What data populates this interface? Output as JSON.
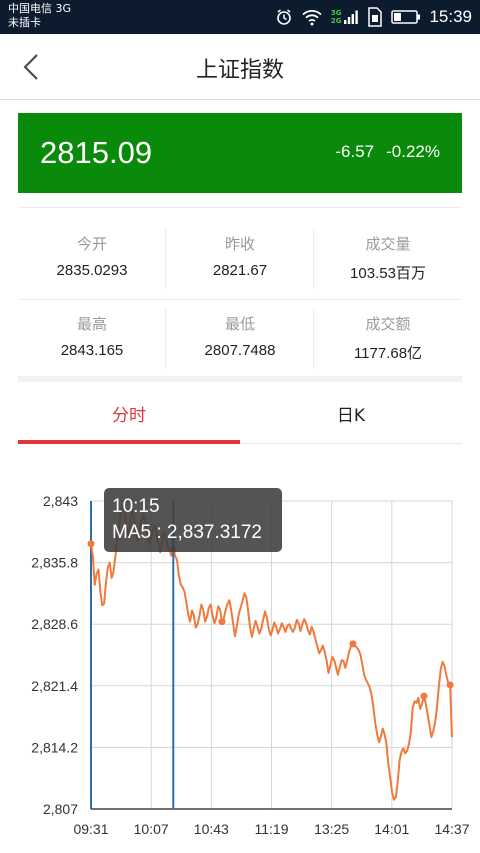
{
  "status_bar": {
    "carrier_line1": "中国电信 3G",
    "carrier_line2": "未插卡",
    "net_top": "3G",
    "net_bottom": "2G",
    "time": "15:39",
    "icons": [
      "alarm-icon",
      "wifi-icon",
      "signal-icon",
      "sim-icon",
      "battery-icon"
    ]
  },
  "header": {
    "title": "上证指数",
    "back_icon": "chevron-left-icon"
  },
  "quote": {
    "price": "2815.09",
    "change": "-6.57",
    "change_pct": "-0.22%",
    "color": "#0a8a0a"
  },
  "stats": [
    {
      "label": "今开",
      "value": "2835.0293"
    },
    {
      "label": "昨收",
      "value": "2821.67"
    },
    {
      "label": "成交量",
      "value": "103.53百万"
    },
    {
      "label": "最高",
      "value": "2843.165"
    },
    {
      "label": "最低",
      "value": "2807.7488"
    },
    {
      "label": "成交额",
      "value": "1177.68亿"
    }
  ],
  "tabs": [
    {
      "label": "分时",
      "active": true
    },
    {
      "label": "日K",
      "active": false
    }
  ],
  "tooltip": {
    "time": "10:15",
    "text": "MA5 : 2,837.3172"
  },
  "chart_data": {
    "type": "line",
    "y_ticks": [
      "2,843",
      "2,835.8",
      "2,828.6",
      "2,821.4",
      "2,814.2",
      "2,807"
    ],
    "x_ticks": [
      "09:31",
      "10:07",
      "10:43",
      "11:19",
      "13:25",
      "14:01",
      "14:37"
    ],
    "ylim": [
      2807,
      2843
    ],
    "line_color": "#f07a3e",
    "crosshair_color": "#2a6fa8",
    "crosshair_index": 44,
    "values": [
      2838.0,
      2836.5,
      2833.2,
      2834.5,
      2835.0,
      2832.4,
      2830.8,
      2831.0,
      2833.5,
      2835.2,
      2835.8,
      2834.0,
      2834.7,
      2836.4,
      2838.5,
      2840.2,
      2841.7,
      2842.4,
      2841.8,
      2840.0,
      2838.9,
      2840.4,
      2841.8,
      2841.1,
      2839.5,
      2838.3,
      2839.6,
      2840.6,
      2841.5,
      2840.6,
      2839.3,
      2837.9,
      2838.6,
      2839.6,
      2840.2,
      2839.2,
      2838.0,
      2837.0,
      2838.2,
      2839.4,
      2838.9,
      2837.6,
      2837.3,
      2836.6,
      2837.3,
      2836.6,
      2836.1,
      2834.3,
      2833.2,
      2832.9,
      2832.4,
      2831.1,
      2829.7,
      2828.9,
      2830.2,
      2829.6,
      2828.2,
      2828.6,
      2829.6,
      2830.9,
      2830.3,
      2828.9,
      2829.5,
      2830.5,
      2830.9,
      2829.6,
      2828.7,
      2829.4,
      2830.7,
      2830.3,
      2828.9,
      2829.3,
      2830.3,
      2831.0,
      2831.4,
      2830.2,
      2828.6,
      2827.2,
      2828.4,
      2829.8,
      2830.5,
      2831.3,
      2832.2,
      2831.8,
      2830.2,
      2828.3,
      2827.1,
      2828.1,
      2829.0,
      2828.3,
      2827.5,
      2828.1,
      2829.1,
      2830.1,
      2829.4,
      2828.1,
      2827.3,
      2827.9,
      2828.8,
      2828.3,
      2827.5,
      2828.0,
      2828.7,
      2828.3,
      2827.7,
      2828.4,
      2828.6,
      2828.1,
      2827.7,
      2828.2,
      2829.1,
      2828.7,
      2827.8,
      2828.6,
      2829.2,
      2828.7,
      2827.9,
      2827.4,
      2828.3,
      2827.7,
      2826.8,
      2826.0,
      2825.2,
      2825.6,
      2826.1,
      2825.3,
      2824.3,
      2822.9,
      2823.8,
      2824.8,
      2824.4,
      2823.6,
      2822.7,
      2823.6,
      2824.4,
      2824.3,
      2823.5,
      2824.4,
      2825.4,
      2826.0,
      2826.3,
      2826.1,
      2825.9,
      2825.6,
      2825.1,
      2824.0,
      2822.7,
      2822.1,
      2821.7,
      2821.2,
      2820.3,
      2818.9,
      2817.0,
      2815.7,
      2814.8,
      2815.5,
      2816.4,
      2815.7,
      2814.6,
      2812.2,
      2810.6,
      2808.9,
      2808.1,
      2808.4,
      2810.3,
      2812.7,
      2813.7,
      2814.1,
      2813.5,
      2813.8,
      2814.6,
      2816.0,
      2818.8,
      2819.6,
      2819.4,
      2820.0,
      2818.7,
      2819.3,
      2820.2,
      2819.3,
      2818.0,
      2816.7,
      2815.4,
      2816.1,
      2817.2,
      2818.9,
      2821.4,
      2823.4,
      2824.2,
      2823.7,
      2822.6,
      2821.7,
      2821.5,
      2815.4
    ]
  }
}
